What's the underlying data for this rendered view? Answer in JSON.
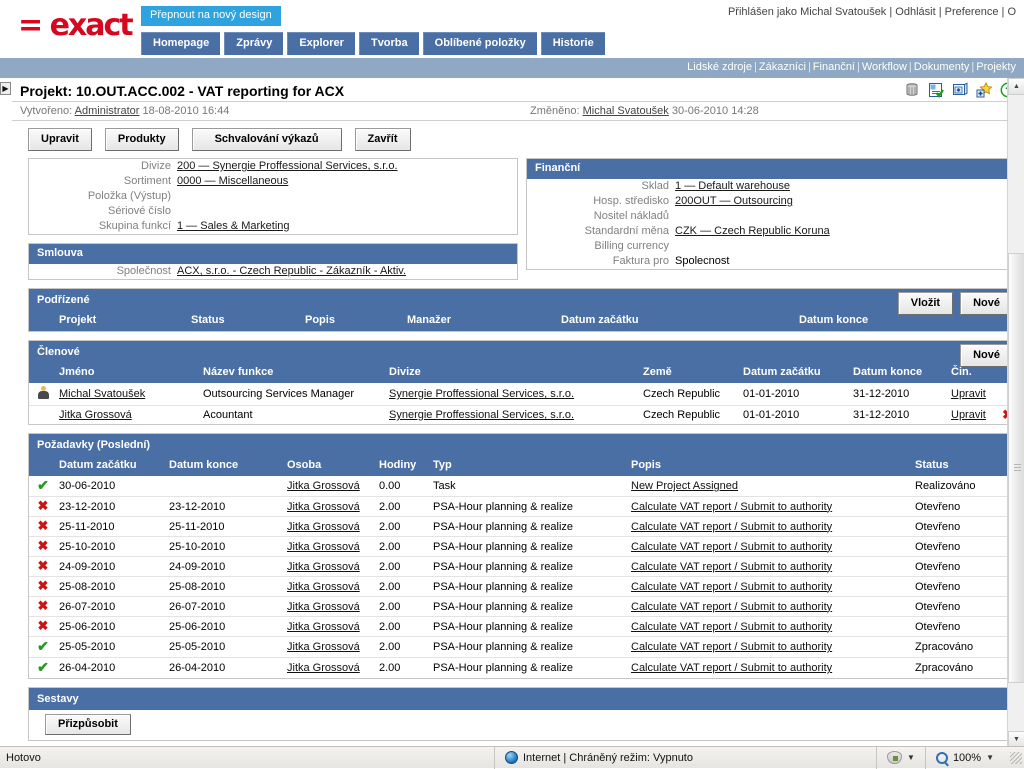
{
  "brand": {
    "logo_text": "= exact",
    "switch_design": "Přepnout na nový design"
  },
  "account": {
    "greeting": "Přihlášen jako Michal Svatoušek",
    "logout": "Odhlásit",
    "preference": "Preference",
    "about": "O",
    "sep": "|"
  },
  "tabs": [
    {
      "label": "Homepage"
    },
    {
      "label": "Zprávy"
    },
    {
      "label": "Explorer"
    },
    {
      "label": "Tvorba"
    },
    {
      "label": "Oblíbené položky"
    },
    {
      "label": "Historie"
    }
  ],
  "subnav": [
    {
      "label": "Lidské zdroje"
    },
    {
      "label": "Zákazníci"
    },
    {
      "label": "Finanční"
    },
    {
      "label": "Workflow"
    },
    {
      "label": "Dokumenty"
    },
    {
      "label": "Projekty"
    }
  ],
  "project": {
    "title": "Projekt: 10.OUT.ACC.002 - VAT reporting for ACX",
    "created_label": "Vytvořeno:",
    "created_by": "Administrator",
    "created_date": "18-08-2010 16:44",
    "changed_label": "Změněno:",
    "changed_by": "Michal Svatoušek",
    "changed_date": "30-06-2010 14:28"
  },
  "head_icons": [
    {
      "name": "archive-icon"
    },
    {
      "name": "checklist-document-icon"
    },
    {
      "name": "add-to-screen-icon"
    },
    {
      "name": "add-favorite-icon"
    },
    {
      "name": "help-icon"
    }
  ],
  "actions": [
    {
      "label": "Upravit"
    },
    {
      "label": "Produkty"
    },
    {
      "label": "Schvalování výkazů"
    },
    {
      "label": "Zavřít"
    }
  ],
  "left_panel": {
    "rows": [
      {
        "key": "Divize",
        "value": "200 — Synergie Proffessional Services, s.r.o.",
        "link": true
      },
      {
        "key": "Sortiment",
        "value": "0000 — Miscellaneous",
        "link": true
      },
      {
        "key": "Položka (Výstup)",
        "value": "",
        "link": false
      },
      {
        "key": "Sériové číslo",
        "value": "",
        "link": false
      },
      {
        "key": "Skupina funkcí",
        "value": "1 — Sales & Marketing",
        "link": true
      }
    ]
  },
  "contract_panel": {
    "title": "Smlouva",
    "rows": [
      {
        "key": "Společnost",
        "value": "ACX, s.r.o. - Czech Republic - Zákazník - Aktiv.",
        "link": true
      }
    ]
  },
  "financial_panel": {
    "title": "Finanční",
    "rows": [
      {
        "key": "Sklad",
        "value": "1 — Default warehouse",
        "link": true
      },
      {
        "key": "Hosp. středisko",
        "value": "200OUT — Outsourcing",
        "link": true
      },
      {
        "key": "Nositel nákladů",
        "value": "",
        "link": false
      },
      {
        "key": "Standardní měna",
        "value": "CZK — Czech Republic Koruna",
        "link": true
      },
      {
        "key": "Billing currency",
        "value": "",
        "link": false
      },
      {
        "key": "Faktura pro",
        "value": "Spolecnost",
        "link": false
      }
    ]
  },
  "subordinates": {
    "title": "Podřízené",
    "buttons": [
      {
        "label": "Vložit"
      },
      {
        "label": "Nové"
      }
    ],
    "columns": [
      "Projekt",
      "Status",
      "Popis",
      "Manažer",
      "Datum začátku",
      "Datum konce"
    ],
    "rows": []
  },
  "members": {
    "title": "Členové",
    "buttons": [
      {
        "label": "Nové"
      }
    ],
    "columns": [
      "Jméno",
      "Název funkce",
      "Divize",
      "Země",
      "Datum začátku",
      "Datum konce",
      "Čin."
    ],
    "rows": [
      {
        "icon": "user-icon",
        "name": "Michal Svatoušek",
        "function": "Outsourcing Services Manager",
        "division": "Synergie Proffessional Services, s.r.o.",
        "country": "Czech Republic",
        "start": "01-01-2010",
        "end": "31-12-2010",
        "action": "Upravit",
        "delete": false
      },
      {
        "icon": "",
        "name": "Jitka Grossová",
        "function": "Acountant",
        "division": "Synergie Proffessional Services, s.r.o.",
        "country": "Czech Republic",
        "start": "01-01-2010",
        "end": "31-12-2010",
        "action": "Upravit",
        "delete": true
      }
    ]
  },
  "requests": {
    "title": "Požadavky (Poslední)",
    "columns": [
      "Datum začátku",
      "Datum konce",
      "Osoba",
      "Hodiny",
      "Typ",
      "Popis",
      "Status"
    ],
    "rows": [
      {
        "status_icon": "check",
        "start": "30-06-2010",
        "end": "",
        "person": "Jitka Grossová",
        "hours": "0.00",
        "type": "Task",
        "desc": "New Project Assigned",
        "status": "Realizováno"
      },
      {
        "status_icon": "cross",
        "start": "23-12-2010",
        "end": "23-12-2010",
        "person": "Jitka Grossová",
        "hours": "2.00",
        "type": "PSA-Hour planning & realize",
        "desc": "Calculate VAT report / Submit to authority",
        "status": "Otevřeno"
      },
      {
        "status_icon": "cross",
        "start": "25-11-2010",
        "end": "25-11-2010",
        "person": "Jitka Grossová",
        "hours": "2.00",
        "type": "PSA-Hour planning & realize",
        "desc": "Calculate VAT report / Submit to authority",
        "status": "Otevřeno"
      },
      {
        "status_icon": "cross",
        "start": "25-10-2010",
        "end": "25-10-2010",
        "person": "Jitka Grossová",
        "hours": "2.00",
        "type": "PSA-Hour planning & realize",
        "desc": "Calculate VAT report / Submit to authority",
        "status": "Otevřeno"
      },
      {
        "status_icon": "cross",
        "start": "24-09-2010",
        "end": "24-09-2010",
        "person": "Jitka Grossová",
        "hours": "2.00",
        "type": "PSA-Hour planning & realize",
        "desc": "Calculate VAT report / Submit to authority",
        "status": "Otevřeno"
      },
      {
        "status_icon": "cross",
        "start": "25-08-2010",
        "end": "25-08-2010",
        "person": "Jitka Grossová",
        "hours": "2.00",
        "type": "PSA-Hour planning & realize",
        "desc": "Calculate VAT report / Submit to authority",
        "status": "Otevřeno"
      },
      {
        "status_icon": "cross",
        "start": "26-07-2010",
        "end": "26-07-2010",
        "person": "Jitka Grossová",
        "hours": "2.00",
        "type": "PSA-Hour planning & realize",
        "desc": "Calculate VAT report / Submit to authority",
        "status": "Otevřeno"
      },
      {
        "status_icon": "cross",
        "start": "25-06-2010",
        "end": "25-06-2010",
        "person": "Jitka Grossová",
        "hours": "2.00",
        "type": "PSA-Hour planning & realize",
        "desc": "Calculate VAT report / Submit to authority",
        "status": "Otevřeno"
      },
      {
        "status_icon": "check",
        "start": "25-05-2010",
        "end": "25-05-2010",
        "person": "Jitka Grossová",
        "hours": "2.00",
        "type": "PSA-Hour planning & realize",
        "desc": "Calculate VAT report / Submit to authority",
        "status": "Zpracováno"
      },
      {
        "status_icon": "check",
        "start": "26-04-2010",
        "end": "26-04-2010",
        "person": "Jitka Grossová",
        "hours": "2.00",
        "type": "PSA-Hour planning & realize",
        "desc": "Calculate VAT report / Submit to authority",
        "status": "Zpracováno"
      }
    ]
  },
  "reports": {
    "title": "Sestavy",
    "customize_label": "Přizpůsobit"
  },
  "statusbar": {
    "left": "Hotovo",
    "zone": "Internet | Chráněný režim: Vypnuto",
    "zoom": "100%"
  },
  "colors": {
    "brand_red": "#d5081f",
    "panel_blue": "#4a6fa5",
    "subnav_blue": "#8fa8c4",
    "switch_cyan": "#2ea3e0",
    "ok_green": "#1d9c1d",
    "error_red": "#cc1414"
  }
}
